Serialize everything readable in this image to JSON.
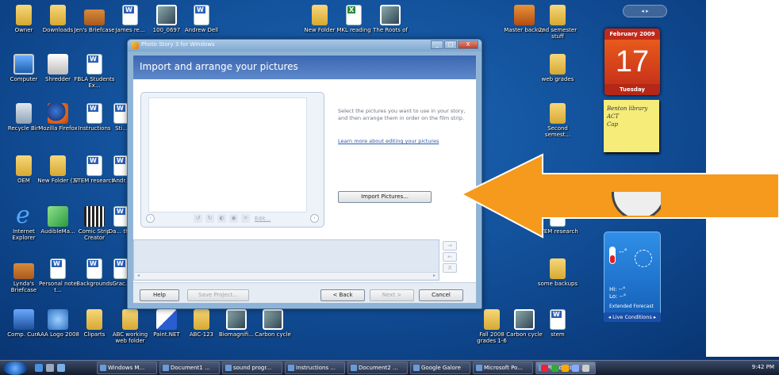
{
  "desktop": {
    "icons": [
      {
        "label": "Owner",
        "icon": "folder-icon"
      },
      {
        "label": "Downloads",
        "icon": "folder-icon"
      },
      {
        "label": "Jen's Briefcase",
        "icon": "briefcase-icon"
      },
      {
        "label": "James re...",
        "icon": "document-icon"
      },
      {
        "label": "100_0697",
        "icon": "photo-icon"
      },
      {
        "label": "Andrew Dell",
        "icon": "document-icon"
      },
      {
        "label": "New Folder",
        "icon": "folder-icon"
      },
      {
        "label": "MKL reading",
        "icon": "excel-icon"
      },
      {
        "label": "The Roots of",
        "icon": "photo-icon"
      },
      {
        "label": "Master backup",
        "icon": "master-backup-icon"
      },
      {
        "label": "2nd semester stuff",
        "icon": "folder-icon"
      },
      {
        "label": "Computer",
        "icon": "computer-icon"
      },
      {
        "label": "Shredder",
        "icon": "shredder-icon"
      },
      {
        "label": "FBLA Students Ex...",
        "icon": "document-icon"
      },
      {
        "label": "web grades",
        "icon": "folder-icon"
      },
      {
        "label": "Recycle Bin",
        "icon": "recycle-bin-icon"
      },
      {
        "label": "Mozilla Firefox",
        "icon": "firefox-icon"
      },
      {
        "label": "Instructions",
        "icon": "document-icon"
      },
      {
        "label": "Sti...",
        "icon": "document-icon"
      },
      {
        "label": "Second semest...",
        "icon": "folder-icon"
      },
      {
        "label": "OEM",
        "icon": "folder-icon"
      },
      {
        "label": "New Folder (3)",
        "icon": "folder-icon"
      },
      {
        "label": "STEM research",
        "icon": "document-icon"
      },
      {
        "label": "Andr...",
        "icon": "document-icon"
      },
      {
        "label": "Internet Explorer",
        "icon": "internet-explorer-icon"
      },
      {
        "label": "AudibleMa...",
        "icon": "audible-icon"
      },
      {
        "label": "Comic Strip Creator",
        "icon": "comic-strip-icon"
      },
      {
        "label": "Da... th...",
        "icon": "document-icon"
      },
      {
        "label": "STEM research",
        "icon": "document-icon"
      },
      {
        "label": "Lynda's Briefcase",
        "icon": "briefcase-icon"
      },
      {
        "label": "Personal note t...",
        "icon": "document-icon"
      },
      {
        "label": "Backgrounds",
        "icon": "document-icon"
      },
      {
        "label": "Grac...",
        "icon": "document-icon"
      },
      {
        "label": "some backups",
        "icon": "folder-icon"
      },
      {
        "label": "Comp. Curr.",
        "icon": "program-icon"
      },
      {
        "label": "AAA Logo 2008",
        "icon": "logo-icon"
      },
      {
        "label": "Cliparts",
        "icon": "folder-icon"
      },
      {
        "label": "ABC working web folder",
        "icon": "folder-icon"
      },
      {
        "label": "Paint.NET",
        "icon": "paint-icon"
      },
      {
        "label": "ABC-123",
        "icon": "folder-icon"
      },
      {
        "label": "Biomagnifi...",
        "icon": "photo-icon"
      },
      {
        "label": "Carbon cycle",
        "icon": "photo-icon"
      },
      {
        "label": "Fall 2008 grades 1-6",
        "icon": "folder-icon"
      },
      {
        "label": "Carbon cycle",
        "icon": "photo-icon"
      },
      {
        "label": "stem",
        "icon": "document-icon"
      }
    ]
  },
  "window": {
    "title": "Photo Story 3 for Windows",
    "controls": [
      "_",
      "□",
      "X"
    ],
    "header": "Import and arrange your pictures",
    "instructions": "Select the pictures you want to use in your story, and then arrange them in order on the film strip.",
    "learn_link": "Learn more about editing your pictures",
    "edit_link": "Edit...",
    "import_button": "Import Pictures...",
    "footer": {
      "help": "Help",
      "save_project": "Save Project...",
      "back": "< Back",
      "next": "Next >",
      "cancel": "Cancel"
    },
    "film_side_buttons": [
      "→",
      "←",
      "X"
    ]
  },
  "gadgets": {
    "nav": "◂ ▸",
    "calendar": {
      "month": "February 2009",
      "day": "17",
      "weekday": "Tuesday"
    },
    "note": [
      "Benton library",
      "ACT",
      "Cap"
    ],
    "weather": {
      "deg": "--°",
      "hi": "Hi: --°",
      "lo": "Lo: --°",
      "forecast": "Extended Forecast",
      "live": "◂ Live Conditions ▸"
    }
  },
  "taskbar": {
    "tasks": [
      {
        "label": "Windows M..."
      },
      {
        "label": "Document1 ..."
      },
      {
        "label": "sound progr..."
      },
      {
        "label": "Instructions ..."
      },
      {
        "label": "Document2 ..."
      },
      {
        "label": "Google Galore"
      },
      {
        "label": "Microsoft Po..."
      },
      {
        "label": "Photo Story ..."
      }
    ],
    "clock": "9:42 PM"
  },
  "colors": {
    "desktop": "#124f98",
    "arrow": "#f59a1c",
    "header": "#3b67b2",
    "calendar": "#c8331a",
    "note": "#f5ec7a"
  }
}
